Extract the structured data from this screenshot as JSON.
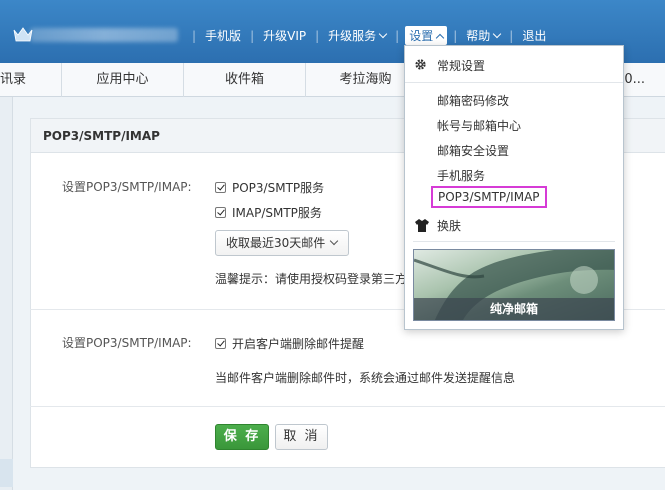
{
  "topnav": {
    "items": [
      "手机版",
      "升级VIP",
      "升级服务",
      "设置",
      "帮助",
      "退出"
    ],
    "separator": "|"
  },
  "tabs": [
    "讯录",
    "应用中心",
    "收件箱",
    "考拉海购",
    "0..."
  ],
  "panel": {
    "title": "POP3/SMTP/IMAP",
    "section1_label": "设置POP3/SMTP/IMAP:",
    "pop3_service": "POP3/SMTP服务",
    "imap_service": "IMAP/SMTP服务",
    "receive_select": "收取最近30天邮件",
    "hint": "温馨提示：请使用授权码登录第三方",
    "section2_label": "设置POP3/SMTP/IMAP:",
    "delete_alert": "开启客户端删除邮件提醒",
    "delete_note": "当邮件客户端删除邮件时，系统会通过邮件发送提醒信息",
    "save": "保 存",
    "cancel": "取 消"
  },
  "dropdown": {
    "general": "常规设置",
    "items": [
      "邮箱密码修改",
      "帐号与邮箱中心",
      "邮箱安全设置",
      "手机服务"
    ],
    "highlighted": "POP3/SMTP/IMAP",
    "skin": "换肤",
    "skin_caption": "纯净邮箱"
  },
  "colors": {
    "topbar": "#2c6fb0",
    "save_green": "#3a973a",
    "highlight_magenta": "#d63bd6"
  }
}
